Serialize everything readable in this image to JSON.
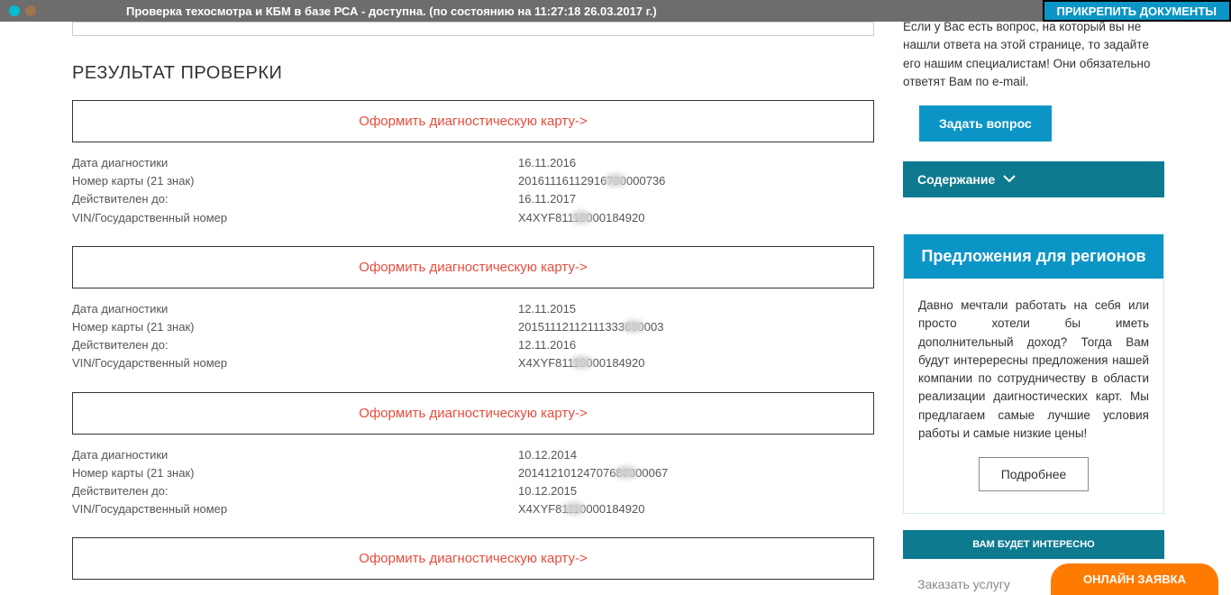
{
  "topbar": {
    "status": "Проверка техосмотра и КБМ в базе РСА - доступна. (по состоянию на 11:27:18 26.03.2017 г.)",
    "attach": "ПРИКРЕПИТЬ ДОКУМЕНТЫ"
  },
  "result_heading": "РЕЗУЛЬТАТ ПРОВЕРКИ",
  "action_link_text": "Оформить диагностическую карту->",
  "labels": {
    "date": "Дата диагностики",
    "card": "Номер карты (21 знак)",
    "valid": "Действителен до:",
    "vin": "VIN/Государственный номер"
  },
  "records": [
    {
      "date": "16.11.2016",
      "card": "20161116112916790000736",
      "valid": "16.11.2017",
      "vin": "X4XYF81110000184920"
    },
    {
      "date": "12.11.2015",
      "card": "20151112112111333600003",
      "valid": "12.11.2016",
      "vin": "X4XYF81110000184920"
    },
    {
      "date": "10.12.2014",
      "card": "20141210124707680000067",
      "valid": "10.12.2015",
      "vin": "X4XYF81110000184920"
    }
  ],
  "sidebar": {
    "intro": "Если у Вас есть вопрос, на который вы не нашли ответа на этой странице, то задайте его нашим специалистам! Они обязательно ответят Вам по e-mail.",
    "ask": "Задать вопрос",
    "contents": "Содержание",
    "regions_title": "Предложения для регионов",
    "regions_body": "Давно мечтали работать на себя или просто хотели бы иметь дополнительный доход? Тогда Вам будут интерересны предложения нашей компании по сотрудничеству в области реализации даигностических карт. Мы предлагаем самые лучшие условия работы и самые низкие цены!",
    "more": "Подробнее",
    "interest": "ВАМ БУДЕТ ИНТЕРЕСНО",
    "order_service": "Заказать    услугу",
    "online": "ОНЛАЙН ЗАЯВКА"
  }
}
